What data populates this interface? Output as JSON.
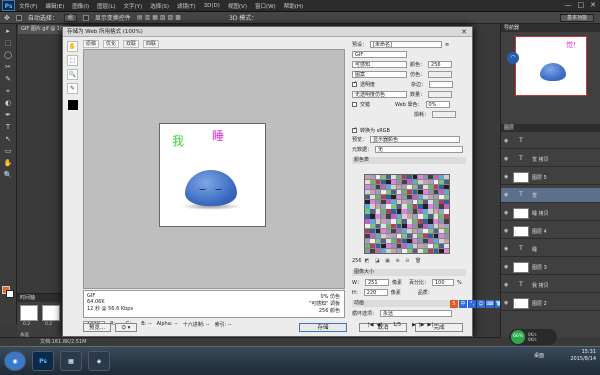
{
  "app": {
    "logo": "Ps",
    "menus": [
      "文件(F)",
      "编辑(E)",
      "图像(I)",
      "图层(L)",
      "文字(Y)",
      "选择(S)",
      "滤镜(T)",
      "3D(D)",
      "视图(V)",
      "窗口(W)",
      "帮助(H)"
    ],
    "window_controls": [
      "—",
      "□",
      "✕"
    ],
    "options": {
      "auto_select": "自动选择：",
      "layer_select": "组",
      "show_transform": "显示变换控件",
      "mode_3d": "3D 模式："
    },
    "workspace": "基本功能",
    "doc_tab": "GIF 图片.gif @ 100",
    "tools": [
      "▸",
      "⬚",
      "◯",
      "✂",
      "✎",
      "⌖",
      "◐",
      "✒",
      "T",
      "↖",
      "▭",
      "✋",
      "🔍"
    ]
  },
  "timeline": {
    "title": "时间轴",
    "frames": [
      {
        "ts": "0.2"
      },
      {
        "ts": "0.2"
      }
    ],
    "loop": "永远"
  },
  "dialog": {
    "title": "存储为 Web 所用格式 (100%)",
    "close": "✕",
    "tabs": [
      "原稿",
      "优化",
      "双联",
      "四联"
    ],
    "tools": [
      "✋",
      "⬚",
      "🔍",
      "✎"
    ],
    "preview": {
      "char1": "我",
      "char2": "睡"
    },
    "stats": {
      "left": [
        "GIF",
        "64.06K",
        "12 秒 @ 56.6 Kbps"
      ],
      "right": [
        "0% 仿色",
        "\"可感知\" 调板",
        "256 颜色"
      ]
    },
    "zoom": {
      "value": "100%",
      "r": "R: --",
      "g": "G: --",
      "b": "B: --",
      "alpha": "Alpha: --",
      "hex": "十六进制: --",
      "index": "索引: --"
    },
    "buttons": {
      "preview": "预览...",
      "device": "⛭ ▾",
      "save": "存储",
      "cancel": "取消",
      "done": "完成"
    },
    "settings": {
      "preset_label": "预设：",
      "preset_value": "[未命名]",
      "format": "GIF",
      "reduction": "可感知",
      "colors_label": "颜色：",
      "colors_value": "256",
      "dither_algo": "图案",
      "dither_label": "仿色：",
      "transparency": "透明度",
      "matte_label": "杂边：",
      "transp_dither": "无透明度仿色",
      "amount_label": "数量：",
      "interlaced": "交错",
      "web_snap_label": "Web 靠色：",
      "web_snap_value": "0%",
      "lossy_label": "损耗：",
      "convert_srgb": "转换为 sRGB",
      "preview_label": "预览：",
      "preview_value": "显示器颜色",
      "metadata_label": "元数据：",
      "metadata_value": "无",
      "color_table": "颜色表",
      "color_count": "256",
      "image_size": "图像大小",
      "w_label": "W：",
      "w_value": "251",
      "h_label": "H：",
      "h_value": "220",
      "unit": "像素",
      "percent_label": "百分比：",
      "percent_value": "100",
      "quality_label": "品质：",
      "animation": "动画",
      "loop_label": "循环选项：",
      "loop_value": "永远",
      "frame_counter": "1/5"
    },
    "ime": [
      "S",
      "中",
      "°,",
      "☺",
      "⌨",
      "👕",
      "⚙"
    ]
  },
  "dock": {
    "navigator_title": "导航器",
    "nav_text": "觉！",
    "layers_title": "图层",
    "layers": [
      {
        "name": "T",
        "label": ""
      },
      {
        "name": "T",
        "label": "觉 拷贝"
      },
      {
        "name": "",
        "label": "图层 5"
      },
      {
        "name": "T",
        "label": "觉"
      },
      {
        "name": "",
        "label": "睡 拷贝"
      },
      {
        "name": "",
        "label": "图层 4"
      },
      {
        "name": "T",
        "label": "睡"
      },
      {
        "name": "",
        "label": "图层 3"
      },
      {
        "name": "T",
        "label": "我 拷贝"
      },
      {
        "name": "",
        "label": "图层 2"
      }
    ]
  },
  "status": {
    "doc": "文档:161.8K/2.51M"
  },
  "taskbar": {
    "apps": [
      "◉",
      "Ps",
      "▦",
      "◈"
    ],
    "tray_label": "桌面",
    "time": "15:31",
    "date": "2015/8/14"
  },
  "perf": {
    "value": "66%",
    "up": "0K/s",
    "down": "0K/s"
  },
  "colors": {
    "accent": "#3a7ab8",
    "fg_swatch": "#ef6a1a",
    "active_layer": "#5b6f8a"
  }
}
